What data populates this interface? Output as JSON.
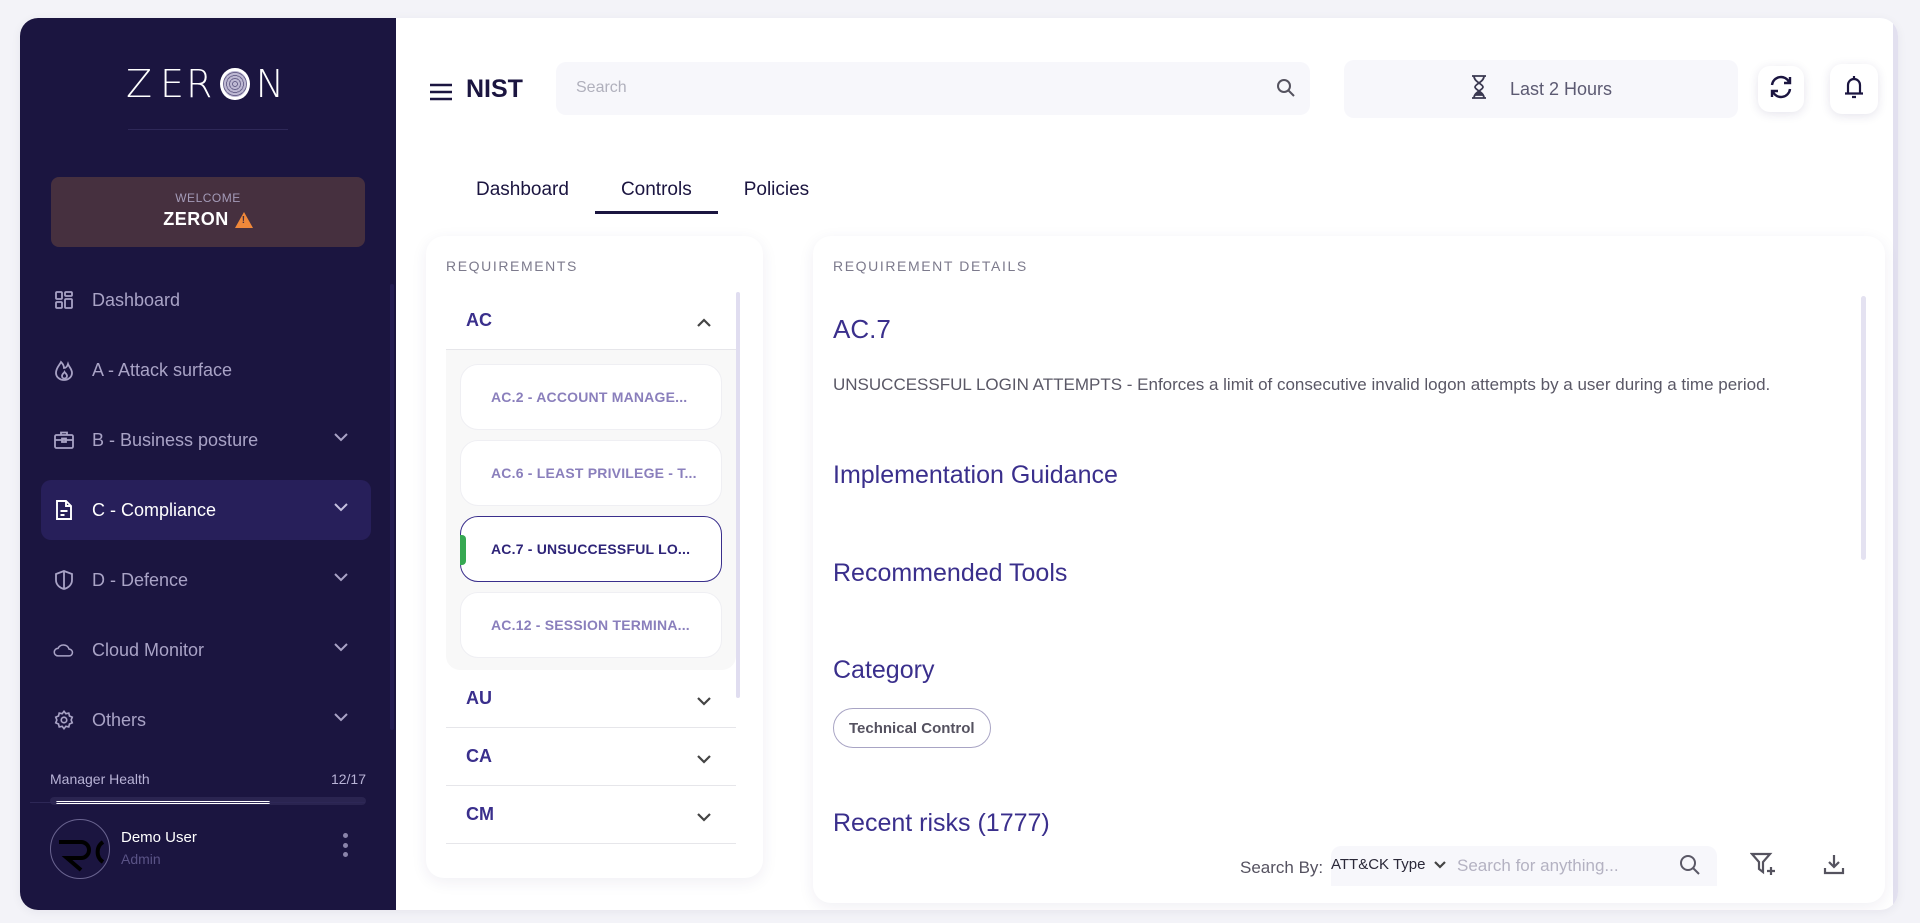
{
  "brand": {
    "logo_text_left": "Z",
    "logo_text_mid": "ER",
    "logo_text_right": "N"
  },
  "sidebar": {
    "welcome_label": "WELCOME",
    "welcome_name": "ZERON",
    "items": [
      {
        "label": "Dashboard",
        "icon": "dashboard-icon",
        "has_chevron": false,
        "active": false
      },
      {
        "label": "A - Attack surface",
        "icon": "flame-icon",
        "has_chevron": false,
        "active": false
      },
      {
        "label": "B - Business posture",
        "icon": "briefcase-icon",
        "has_chevron": true,
        "active": false
      },
      {
        "label": "C - Compliance",
        "icon": "document-icon",
        "has_chevron": true,
        "active": true
      },
      {
        "label": "D - Defence",
        "icon": "shield-icon",
        "has_chevron": true,
        "active": false
      },
      {
        "label": "Cloud Monitor",
        "icon": "cloud-icon",
        "has_chevron": true,
        "active": false
      },
      {
        "label": "Others",
        "icon": "gear-icon",
        "has_chevron": true,
        "active": false
      }
    ],
    "health": {
      "label": "Manager Health",
      "value_text": "12/17",
      "current": 12,
      "total": 17
    },
    "user": {
      "name": "Demo User",
      "role": "Admin"
    }
  },
  "header": {
    "title": "NIST",
    "search_placeholder": "Search",
    "time_range": "Last 2 Hours"
  },
  "tabs": [
    {
      "label": "Dashboard",
      "active": false
    },
    {
      "label": "Controls",
      "active": true
    },
    {
      "label": "Policies",
      "active": false
    }
  ],
  "requirements": {
    "heading": "REQUIREMENTS",
    "groups": [
      {
        "code": "AC",
        "expanded": true,
        "items": [
          {
            "label": "AC.2 - ACCOUNT MANAGE...",
            "selected": false
          },
          {
            "label": "AC.6 - LEAST PRIVILEGE - T...",
            "selected": false
          },
          {
            "label": "AC.7 - UNSUCCESSFUL LO...",
            "selected": true
          },
          {
            "label": "AC.12 - SESSION TERMINA...",
            "selected": false
          }
        ]
      },
      {
        "code": "AU",
        "expanded": false
      },
      {
        "code": "CA",
        "expanded": false
      },
      {
        "code": "CM",
        "expanded": false
      }
    ]
  },
  "details": {
    "heading": "REQUIREMENT DETAILS",
    "code": "AC.7",
    "description": "UNSUCCESSFUL LOGIN ATTEMPTS - Enforces a limit of consecutive invalid logon attempts by a user during a time period.",
    "implementation_heading": "Implementation Guidance",
    "tools_heading": "Recommended Tools",
    "category_heading": "Category",
    "category_chip": "Technical Control",
    "risks_heading": "Recent risks (1777)",
    "search_by_label": "Search By:",
    "search_by_value": "ATT&CK Type",
    "search_placeholder": "Search for anything..."
  },
  "colors": {
    "sidebar_bg": "#1b1540",
    "accent": "#3a2f8c",
    "selected_marker": "#36a852",
    "warning": "#f0883a"
  }
}
